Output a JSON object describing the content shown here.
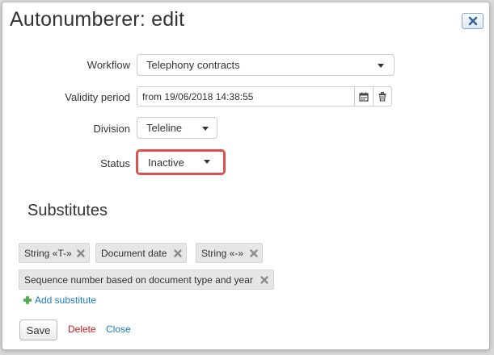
{
  "dialog": {
    "title": "Autonumberer: edit",
    "close_icon": "close-icon"
  },
  "form": {
    "workflow": {
      "label": "Workflow",
      "value": "Telephony contracts"
    },
    "validity": {
      "label": "Validity period",
      "value": "from 19/06/2018 14:38:55",
      "calendar_icon": "calendar-icon",
      "trash_icon": "trash-icon"
    },
    "division": {
      "label": "Division",
      "value": "Teleline"
    },
    "status": {
      "label": "Status",
      "value": "Inactive",
      "highlight_color": "#d9534f"
    }
  },
  "substitutes": {
    "heading": "Substitutes",
    "items": [
      "String «T-»",
      "Document date",
      "String «-»",
      "Sequence number based on document type and year"
    ],
    "add_label": "Add substitute"
  },
  "actions": {
    "save": "Save",
    "delete": "Delete",
    "close": "Close"
  },
  "colors": {
    "link": "#1a7ac4",
    "danger": "#cc1818",
    "add_icon": "#4cae4c"
  }
}
